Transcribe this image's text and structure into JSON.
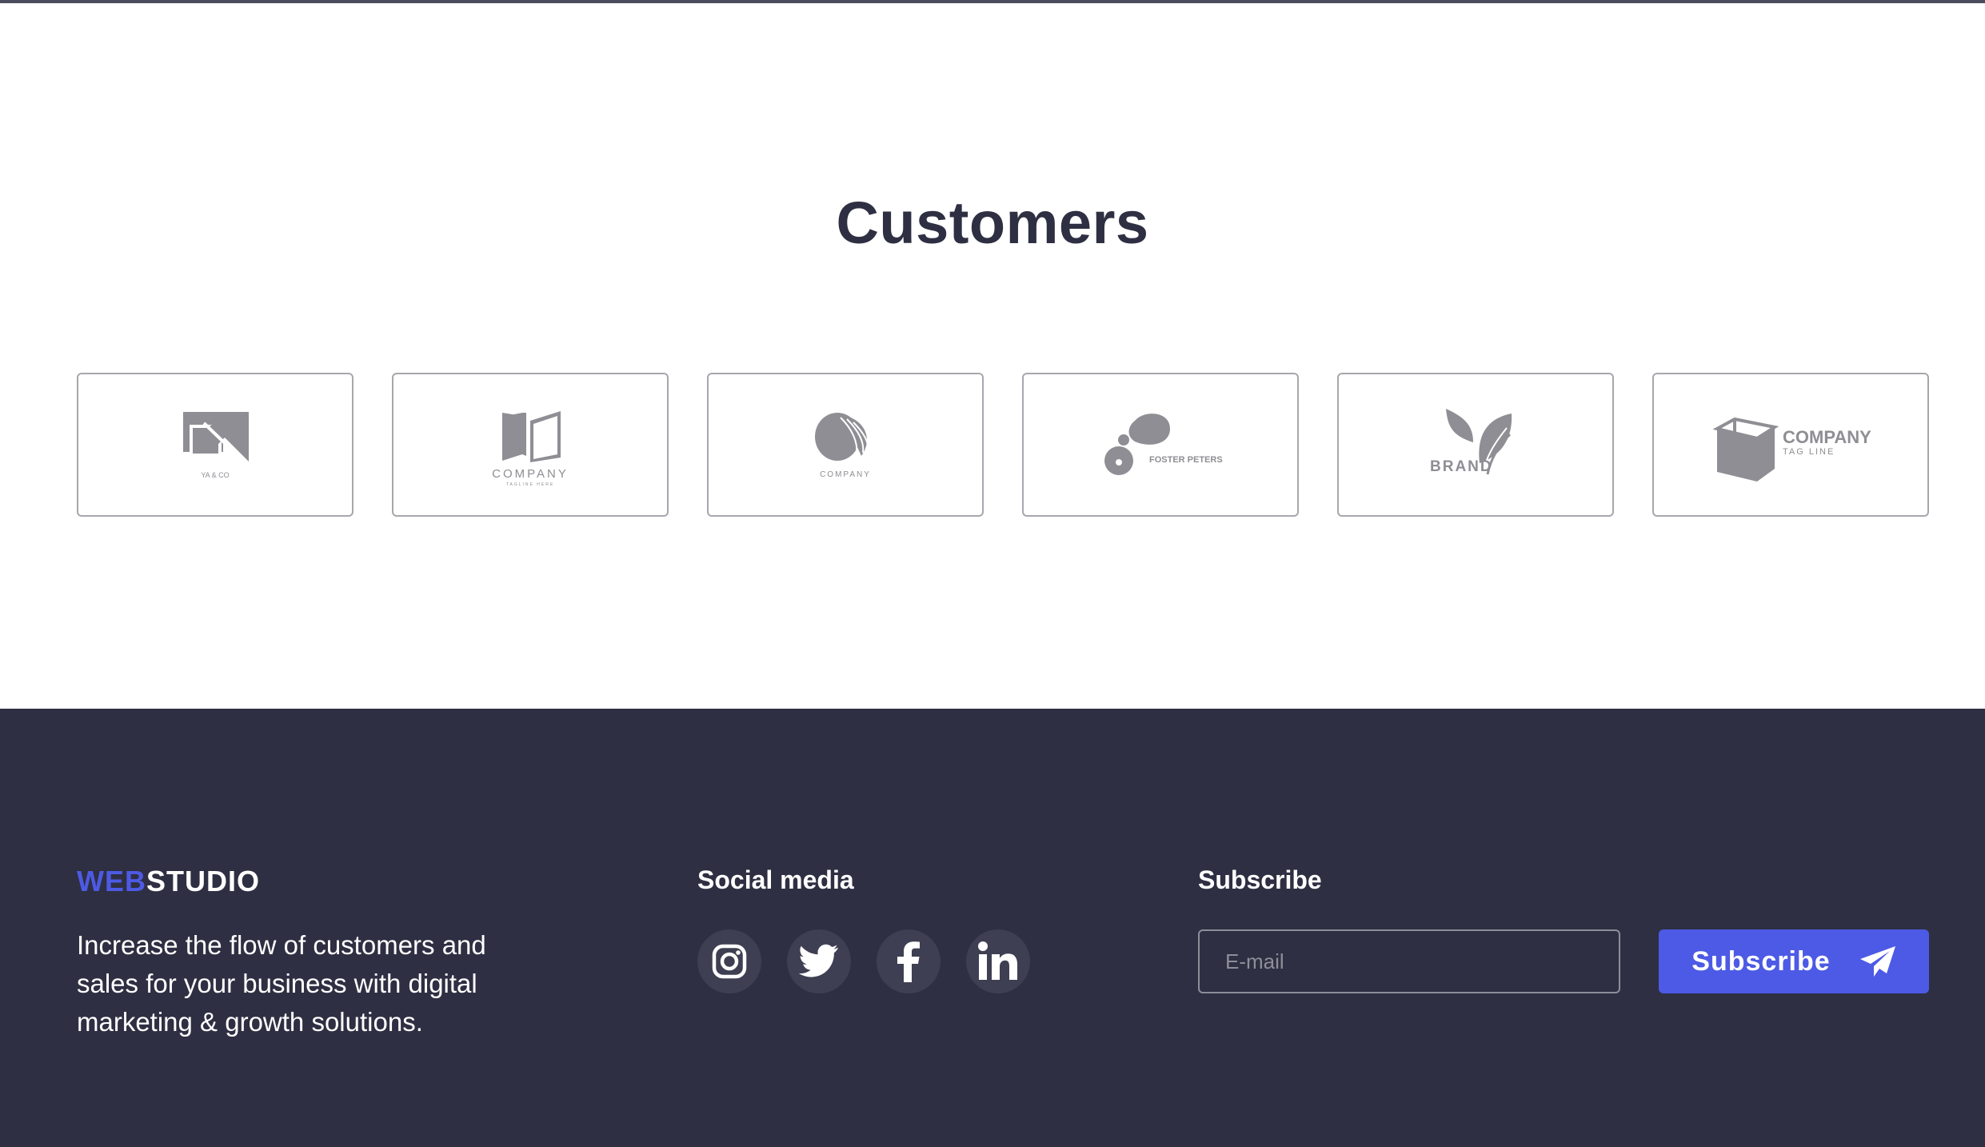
{
  "customers": {
    "title": "Customers",
    "logos": [
      {
        "name": "YA & CO",
        "icon": "square-arrow-logo"
      },
      {
        "name": "COMPANY",
        "tagline": "TAGLINE HERE",
        "icon": "open-book-logo"
      },
      {
        "name": "COMPANY",
        "icon": "layered-leaf-logo"
      },
      {
        "name": "FOSTER PETERS",
        "icon": "speech-drop-logo"
      },
      {
        "name": "BRAND",
        "icon": "twin-leaf-logo"
      },
      {
        "name": "COMPANY",
        "tagline": "TAG LINE",
        "icon": "cube-logo"
      }
    ]
  },
  "footer": {
    "brand": {
      "accent": "WEB",
      "main": "STUDIO"
    },
    "tagline": "Increase the flow of customers and sales for your business with digital marketing & growth solutions.",
    "social": {
      "title": "Social media",
      "links": [
        {
          "icon": "instagram-icon"
        },
        {
          "icon": "twitter-icon"
        },
        {
          "icon": "facebook-icon"
        },
        {
          "icon": "linkedin-icon"
        }
      ]
    },
    "subscribe": {
      "title": "Subscribe",
      "placeholder": "E-mail",
      "button_label": "Subscribe",
      "button_icon": "paper-plane-icon"
    }
  },
  "colors": {
    "accent": "#4d5ae5",
    "footer_bg": "#2e2f42",
    "heading": "#2e2f42",
    "logo_gray": "#8e8e94"
  }
}
